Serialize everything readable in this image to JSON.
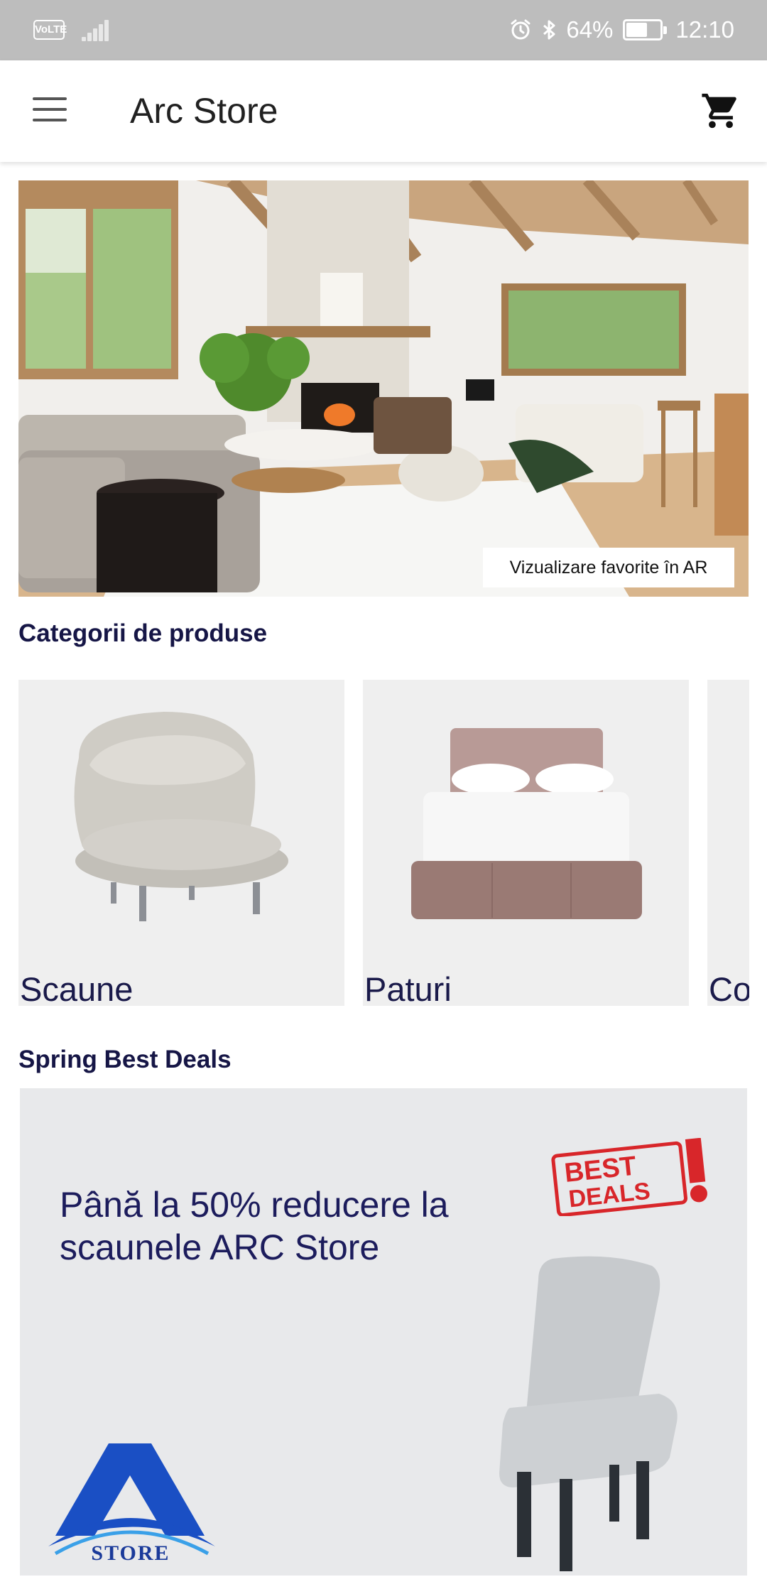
{
  "status_bar": {
    "volte": "VoLTE",
    "battery": "64%",
    "battery_level": 0.64,
    "time": "12:10",
    "icons": [
      "signal-icon",
      "alarm-icon",
      "bluetooth-icon",
      "battery-icon"
    ]
  },
  "app_bar": {
    "title": "Arc Store",
    "icons": [
      "menu-icon",
      "cart-icon"
    ]
  },
  "hero": {
    "ar_button_label": "Vizualizare favorite în AR"
  },
  "categories": {
    "title": "Categorii de produse",
    "items": [
      {
        "label": "Scaune"
      },
      {
        "label": "Paturi"
      },
      {
        "label": "Co"
      }
    ]
  },
  "deals": {
    "title": "Spring Best Deals",
    "banner_text": "Până la 50% reducere la scaunele ARC Store",
    "stamp_line1": "BEST",
    "stamp_line2": "DEALS",
    "logo_text": "STORE"
  },
  "colors": {
    "status_bar": "#bdbdbd",
    "heading": "#161646",
    "banner_text": "#1c1c5c",
    "card_bg": "#efefef",
    "stamp_red": "#d8262a",
    "logo_blue": "#1a4fc4"
  }
}
